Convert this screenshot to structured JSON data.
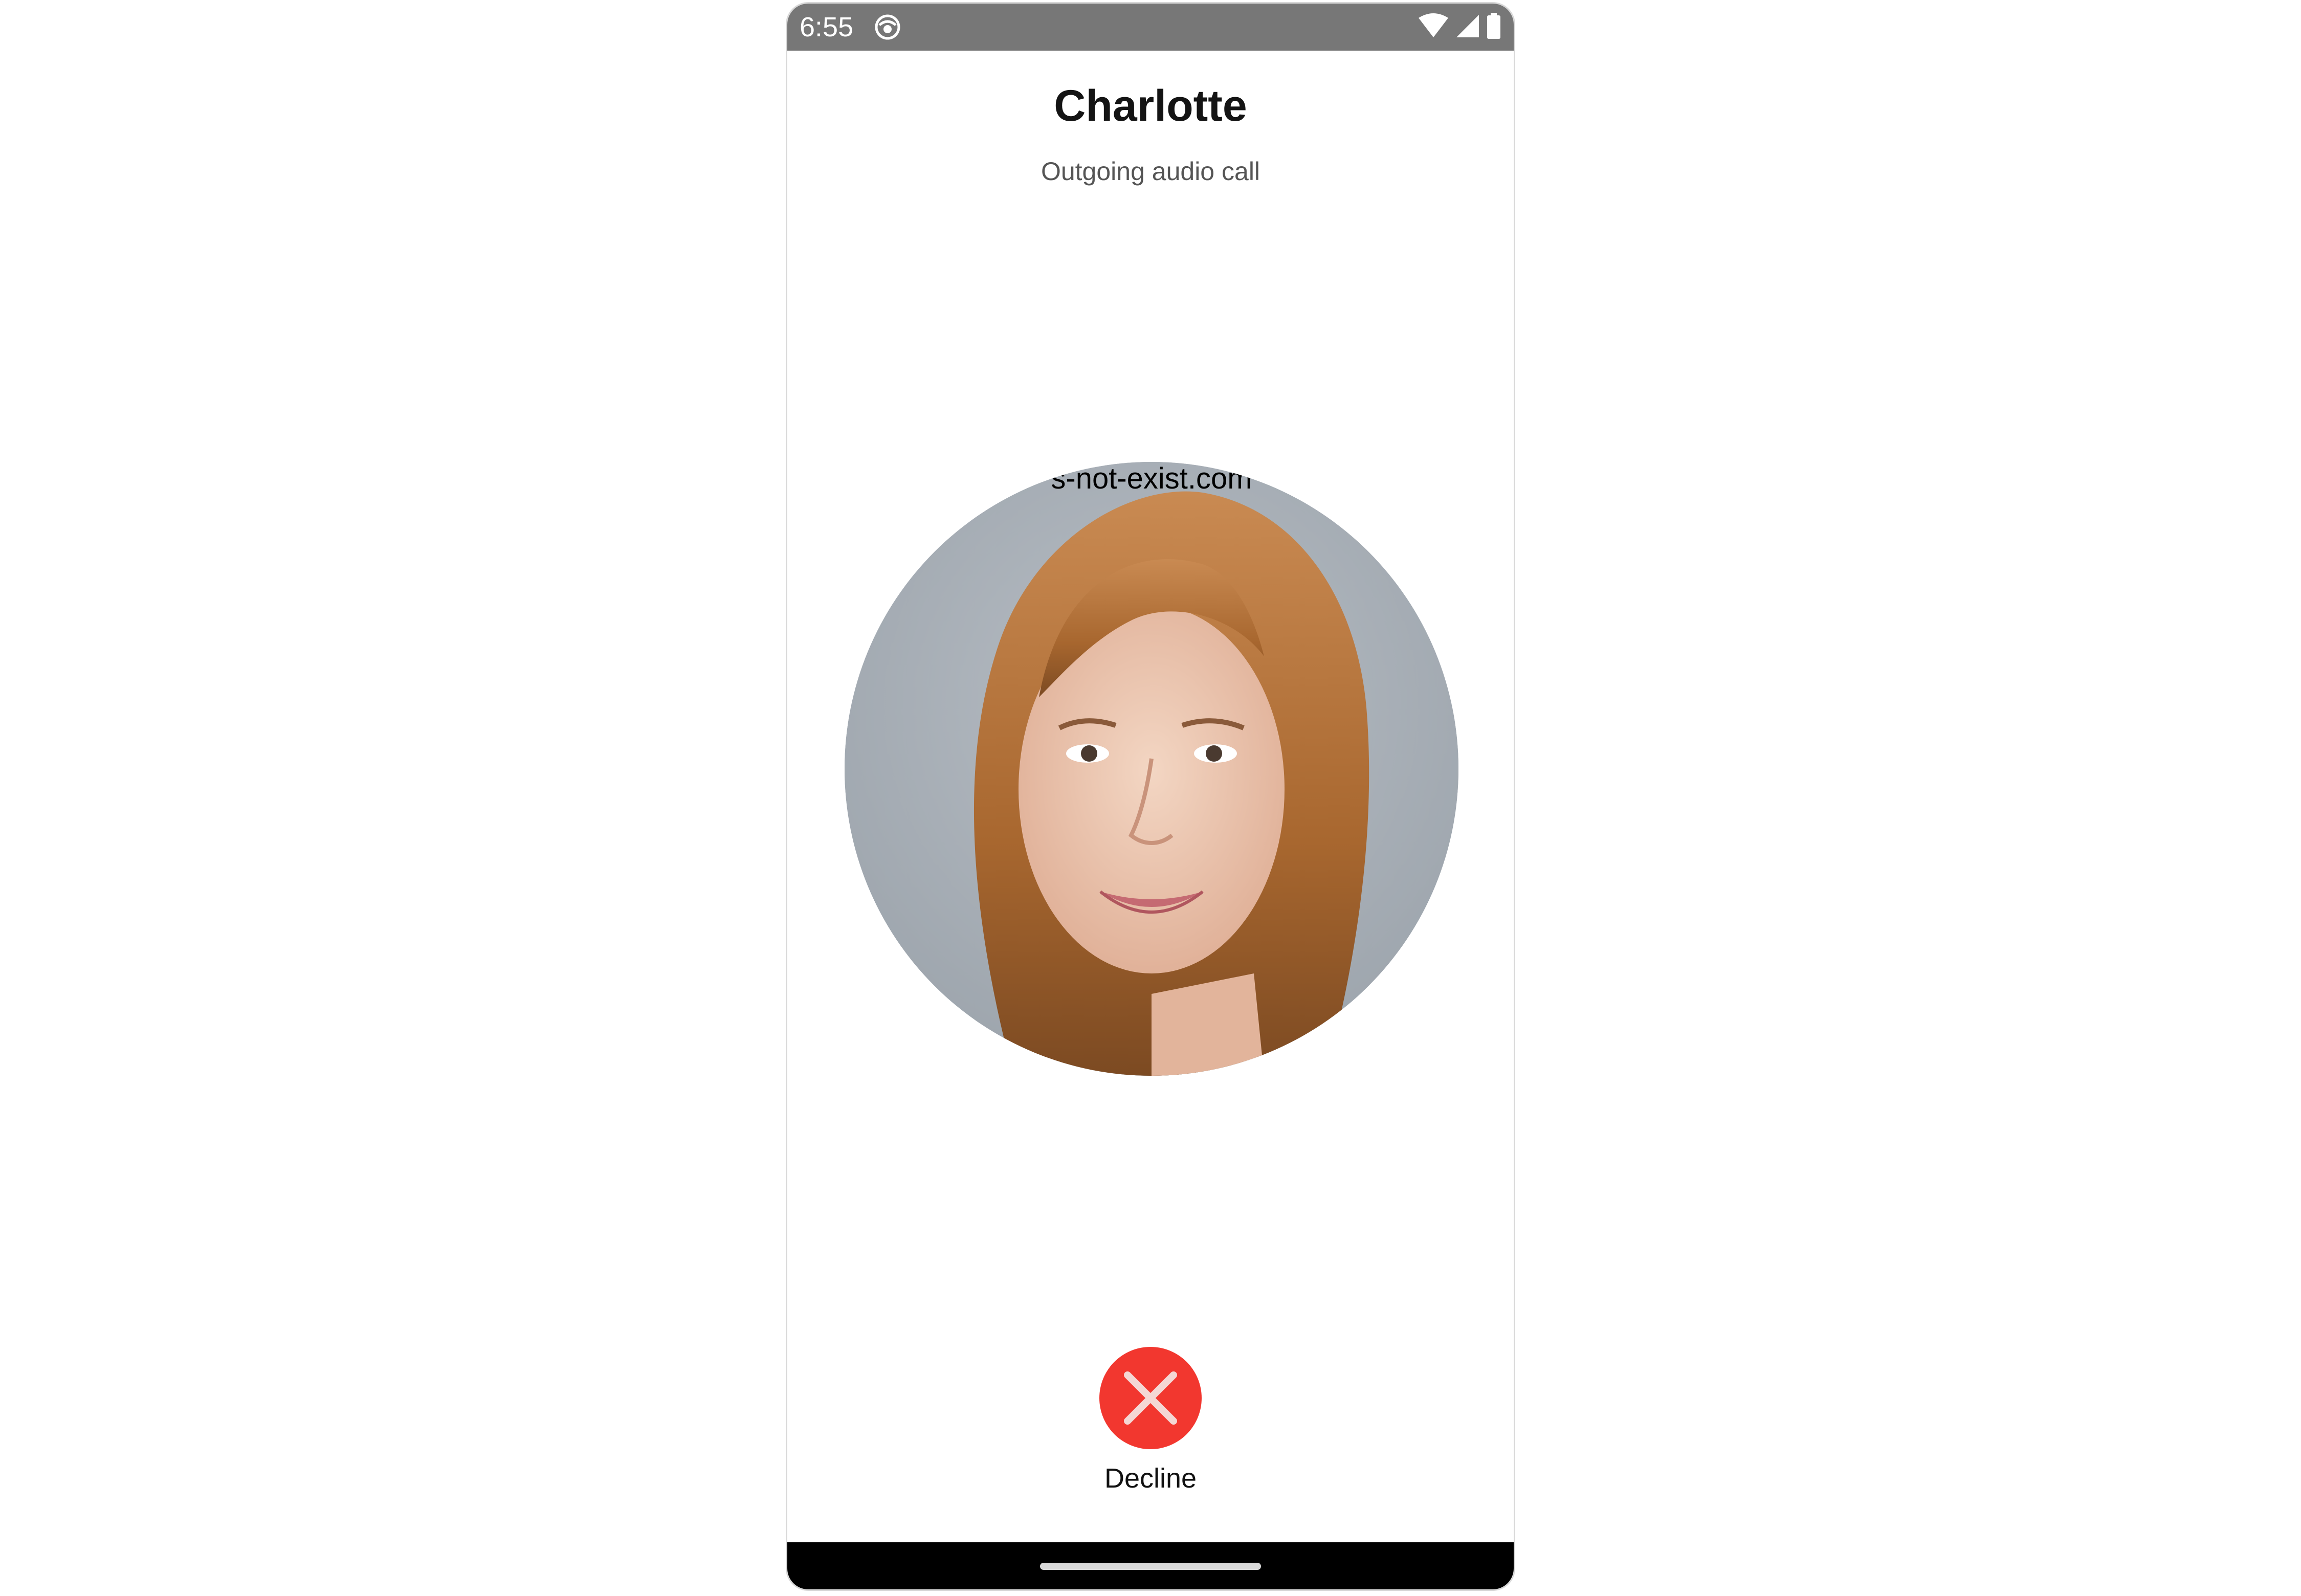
{
  "status_bar": {
    "time": "6:55",
    "app_icon": "notification-app-icon",
    "icons": [
      "wifi-icon",
      "cell-signal-icon",
      "battery-icon"
    ],
    "background": "#777777"
  },
  "call": {
    "caller_name": "Charlotte",
    "status": "Outgoing audio call",
    "avatar_watermark": "s-not-exist.com"
  },
  "actions": {
    "decline_label": "Decline",
    "decline_icon": "close-icon",
    "decline_color": "#f2372f"
  },
  "nav_bar": {
    "handle": "home-handle"
  }
}
